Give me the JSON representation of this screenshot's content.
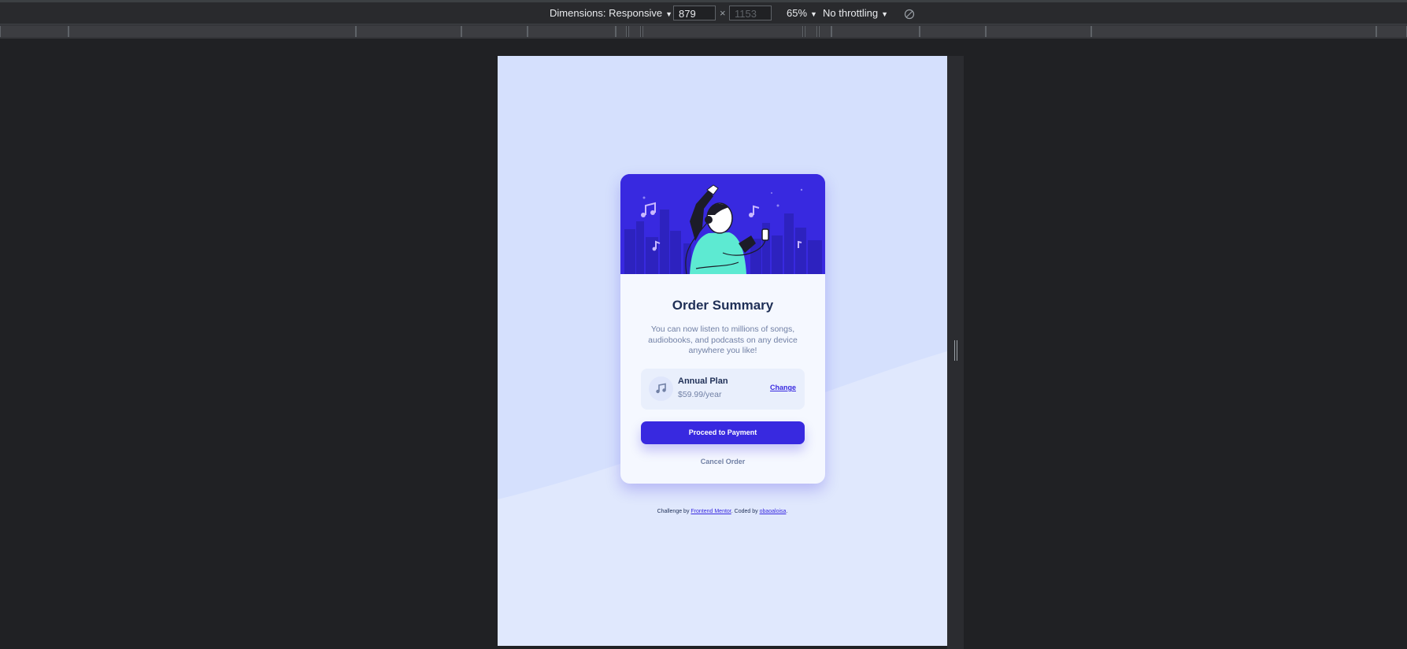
{
  "devtools": {
    "dimensions_label": "Dimensions: Responsive",
    "width_value": "879",
    "times": "×",
    "height_value": "1153",
    "zoom": "65%",
    "throttling": "No throttling",
    "caret": "▼"
  },
  "card": {
    "title": "Order Summary",
    "description": "You can now listen to millions of songs, audiobooks, and podcasts on any device anywhere you like!",
    "plan": {
      "name": "Annual Plan",
      "price": "$59.99/year",
      "change_label": "Change",
      "icon": "music-note-icon"
    },
    "pay_button": "Proceed to Payment",
    "cancel_button": "Cancel Order"
  },
  "attribution": {
    "prefix": "Challenge by ",
    "link1": "Frontend Mentor",
    "middle": ". Coded by ",
    "link2": "obaoaloisa",
    "suffix": "."
  },
  "colors": {
    "page_bg": "#d5e0fd",
    "accent": "#3829e0",
    "heading": "#1f2f56",
    "muted": "#7180a5",
    "card_bg": "#f5f8ff"
  }
}
